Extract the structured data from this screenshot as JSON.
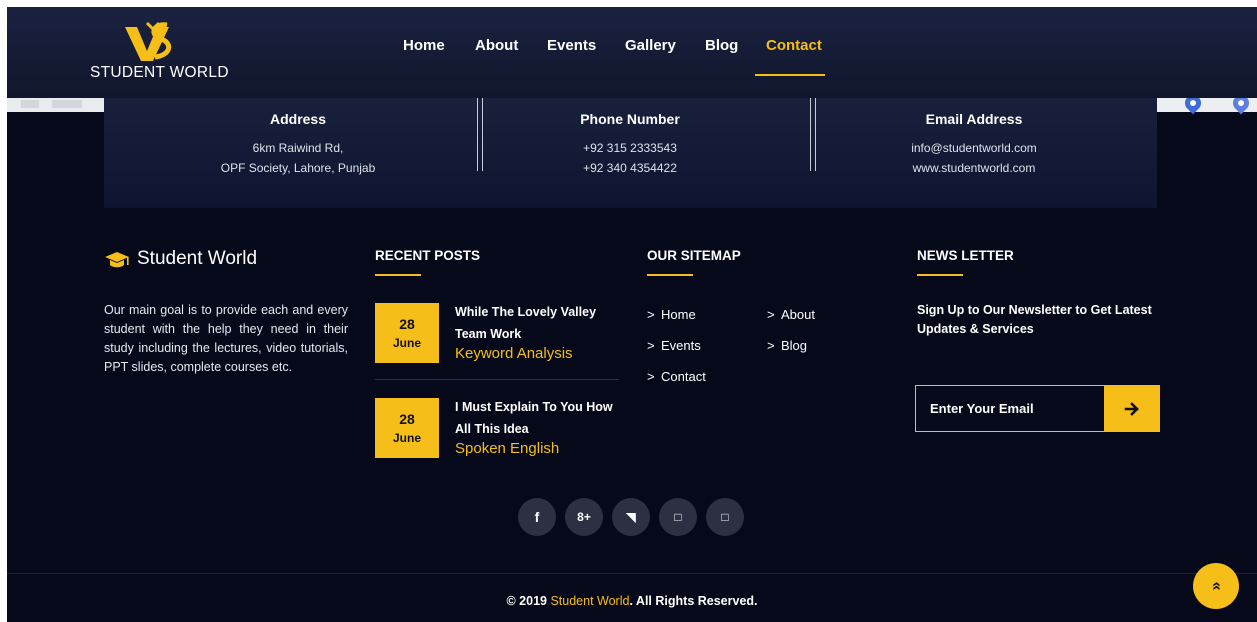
{
  "header": {
    "logo_text": "STUDENT WORLD",
    "nav": [
      {
        "label": "Home"
      },
      {
        "label": "About"
      },
      {
        "label": "Events"
      },
      {
        "label": "Gallery"
      },
      {
        "label": "Blog"
      },
      {
        "label": "Contact",
        "active": true
      }
    ]
  },
  "contact": {
    "address": {
      "title": "Address",
      "line1": "6km Raiwind Rd,",
      "line2": "OPF Society, Lahore, Punjab"
    },
    "phone": {
      "title": "Phone Number",
      "line1": "+92 315 2333543",
      "line2": "+92 340 4354422"
    },
    "email": {
      "title": "Email Address",
      "line1": "info@studentworld.com",
      "line2": "www.studentworld.com"
    }
  },
  "brand": {
    "icon": "graduation-cap-icon",
    "name": "Student World",
    "description": "Our main goal is to provide each and every student with the help they need in their study including the lectures, video tutorials, PPT slides, complete courses etc."
  },
  "recent_posts": {
    "title": "RECENT POSTS",
    "posts": [
      {
        "day": "28",
        "month": "June",
        "title_line1": "While The Lovely Valley",
        "title_line2": "Team Work",
        "category": "Keyword Analysis"
      },
      {
        "day": "28",
        "month": "June",
        "title_line1": "I Must Explain To You How",
        "title_line2": "All This Idea",
        "category": "Spoken English"
      }
    ]
  },
  "sitemap": {
    "title": "OUR SITEMAP",
    "chevron": ">",
    "links": [
      "Home",
      "About",
      "Events",
      "Blog",
      "Contact"
    ]
  },
  "newsletter": {
    "title": "NEWS LETTER",
    "text": "Sign Up to Our Newsletter to Get Latest Updates & Services",
    "placeholder": "Enter Your Email",
    "button_icon": "arrow-right-icon"
  },
  "social": {
    "icons": [
      "facebook-icon",
      "google-plus-icon",
      "twitter-icon",
      "placeholder-icon",
      "placeholder-icon"
    ],
    "glyphs": [
      "f",
      "8+",
      "◥",
      "□",
      "□"
    ]
  },
  "footer": {
    "copyright_prefix": "© 2019",
    "copyright_brand": "Student World",
    "copyright_suffix": ". All Rights Reserved."
  },
  "scroll_top": {
    "icon": "double-chevron-up-icon",
    "glyph": "»"
  },
  "colors": {
    "accent": "#f6be18",
    "background": "#06091a",
    "header": "#151b35"
  }
}
